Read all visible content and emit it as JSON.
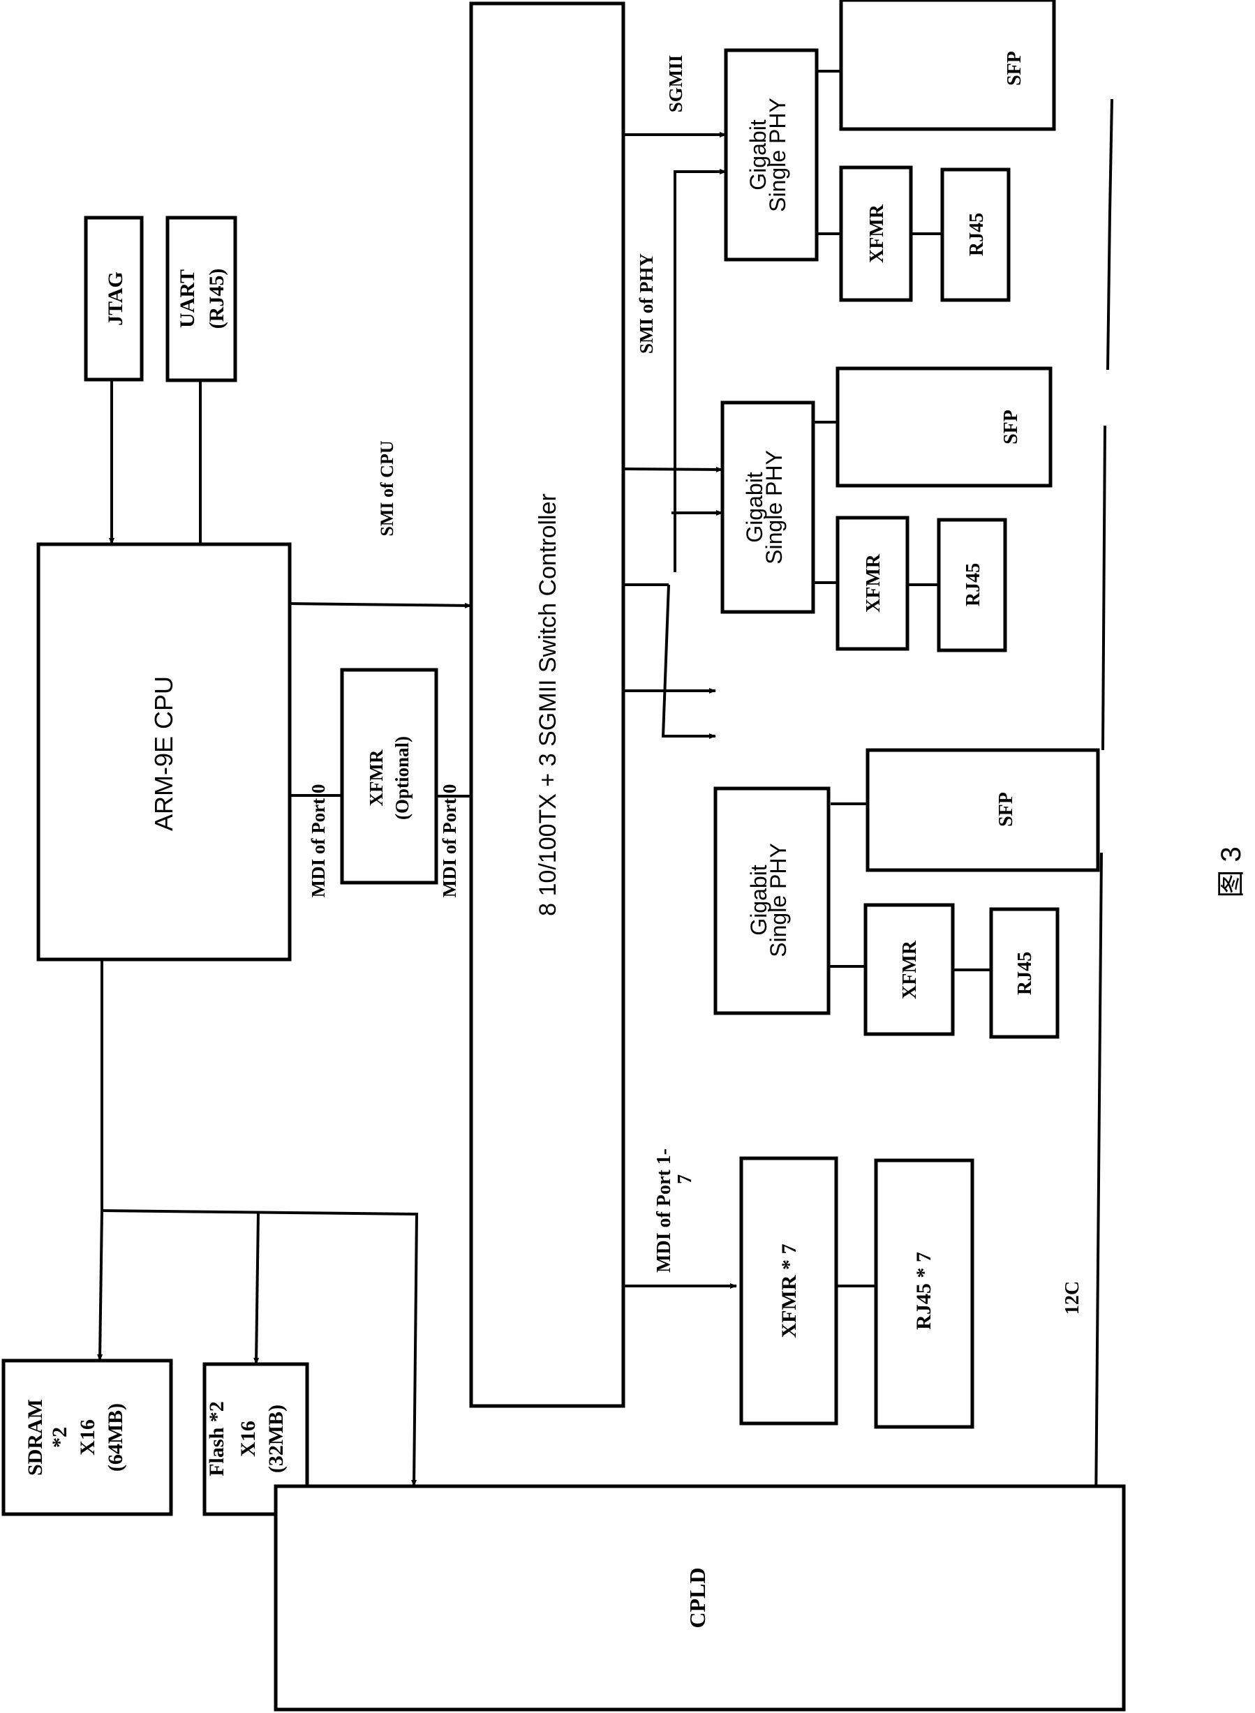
{
  "figure_label": "图 3",
  "blocks": {
    "jtag": "JTAG",
    "uart": [
      "UART",
      "(RJ45)"
    ],
    "cpu": "ARM-9E CPU",
    "xfmr_optional": [
      "XFMR",
      "(Optional)"
    ],
    "switch": "8 10/100TX + 3 SGMII Switch Controller",
    "sdram": [
      "SDRAM",
      "*2",
      "X16",
      "(64MB)"
    ],
    "flash": [
      "Flash *2",
      "X16",
      "(32MB)"
    ],
    "cpld": "CPLD",
    "xfmr7": "XFMR * 7",
    "rj45x7": "RJ45 * 7",
    "phy": [
      "Gigabit",
      "Single PHY"
    ],
    "sfp": "SFP",
    "xfmr": "XFMR",
    "rj45": "RJ45"
  },
  "signals": {
    "smi_cpu": "SMI of CPU",
    "mdi_port0_a": "MDI of Port 0",
    "mdi_port0_b": "MDI of Port 0",
    "sgmii": "SGMII",
    "smi_phy": "SMI of PHY",
    "mdi_port1_7": [
      "MDI of Port 1-",
      "7"
    ],
    "i2c": "12C"
  },
  "phy_groups": [
    {
      "phy": [
        "Gigabit",
        "Single PHY"
      ],
      "sfp": "SFP",
      "xfmr": "XFMR",
      "rj45": "RJ45"
    },
    {
      "phy": [
        "Gigabit",
        "Single PHY"
      ],
      "sfp": "SFP",
      "xfmr": "XFMR",
      "rj45": "RJ45"
    },
    {
      "phy": [
        "Gigabit",
        "Single PHY"
      ],
      "sfp": "SFP",
      "xfmr": "XFMR",
      "rj45": "RJ45"
    }
  ]
}
